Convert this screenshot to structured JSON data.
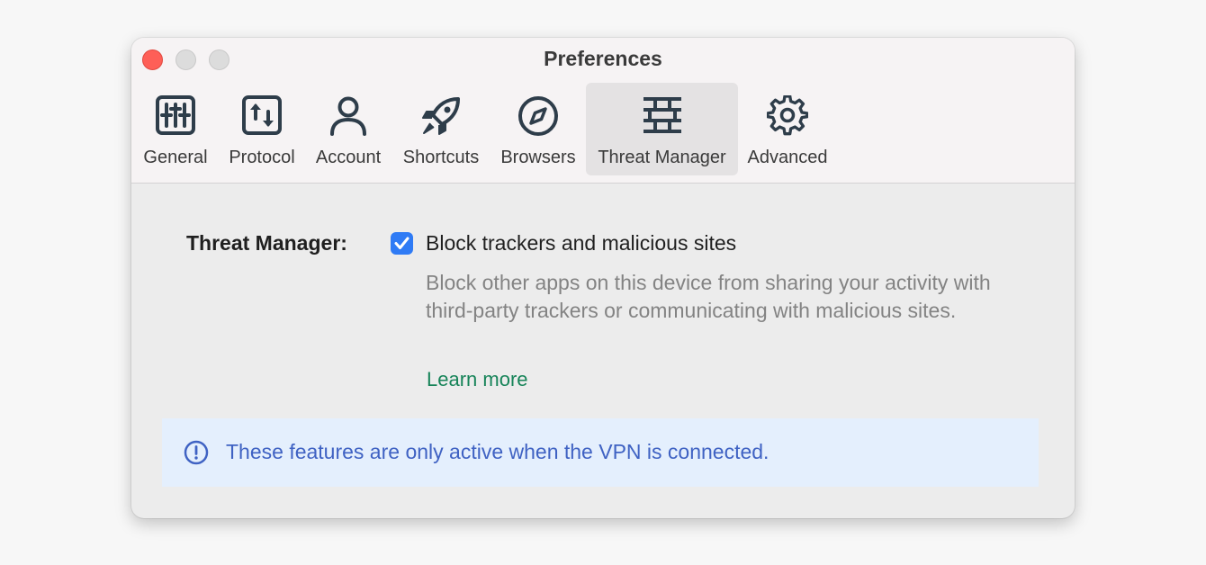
{
  "window": {
    "title": "Preferences"
  },
  "tabs": [
    {
      "label": "General",
      "icon": "sliders-icon"
    },
    {
      "label": "Protocol",
      "icon": "protocol-arrows-icon"
    },
    {
      "label": "Account",
      "icon": "person-icon"
    },
    {
      "label": "Shortcuts",
      "icon": "rocket-icon"
    },
    {
      "label": "Browsers",
      "icon": "compass-icon"
    },
    {
      "label": "Threat Manager",
      "icon": "firewall-icon",
      "selected": true
    },
    {
      "label": "Advanced",
      "icon": "gear-icon"
    }
  ],
  "threat_manager": {
    "label": "Threat Manager:",
    "checkbox_label": "Block trackers and malicious sites",
    "checked": true,
    "description": "Block other apps on this device from sharing your activity with third-party trackers or communicating with malicious sites.",
    "learn_more": "Learn more"
  },
  "banner": {
    "icon": "info-icon",
    "text": "These features are only active when the VPN is connected."
  },
  "colors": {
    "accent_blue": "#2f7bf5",
    "link_green": "#178459",
    "banner_bg": "#e4effd",
    "banner_text": "#3f62c3",
    "close_red": "#fe5f57"
  }
}
